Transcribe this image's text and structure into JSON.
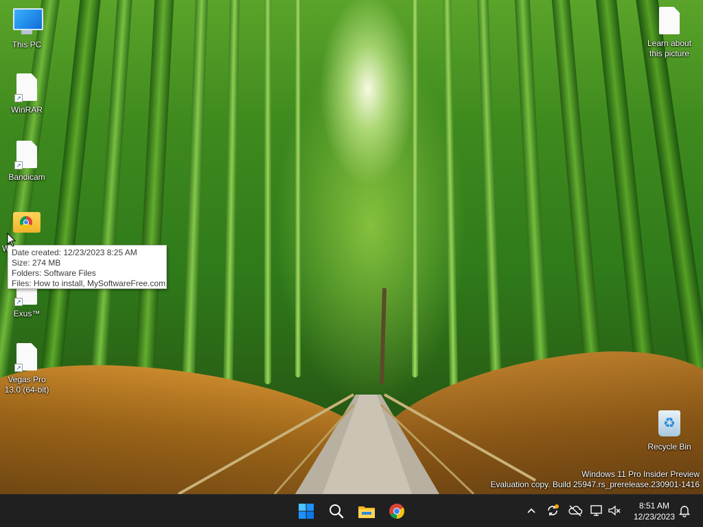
{
  "desktop": {
    "icons": {
      "this_pc": "This PC",
      "winrar": "WinRAR",
      "bandicam": "Bandicam",
      "folder_partial": "W",
      "exus": "Exus™",
      "vegas_line1": "Vegas Pro",
      "vegas_line2": "13.0 (64-bit)",
      "learn_line1": "Learn about",
      "learn_line2": "this picture",
      "recycle_bin": "Recycle Bin"
    },
    "tooltip": {
      "date_created": "Date created: 12/23/2023 8:25 AM",
      "size": "Size: 274 MB",
      "folders": "Folders: Software Files",
      "files": "Files: How to install, MySoftwareFree.com"
    },
    "watermark": {
      "line1": "Windows 11 Pro Insider Preview",
      "line2": "Evaluation copy. Build 25947.rs_prerelease.230901-1416"
    }
  },
  "taskbar": {
    "apps": [
      "start-icon",
      "search-icon",
      "file-explorer-icon",
      "chrome-icon"
    ],
    "tray_icons": [
      "chevron-up-icon",
      "sync-icon",
      "onedrive-icon",
      "network-icon",
      "volume-muted-icon",
      "notification-bell-icon"
    ],
    "clock": {
      "time": "8:51 AM",
      "date": "12/23/2023"
    }
  },
  "colors": {
    "taskbar_bg": "#202020",
    "tooltip_bg": "#ffffff",
    "windows_blue": "#1e90ff"
  }
}
